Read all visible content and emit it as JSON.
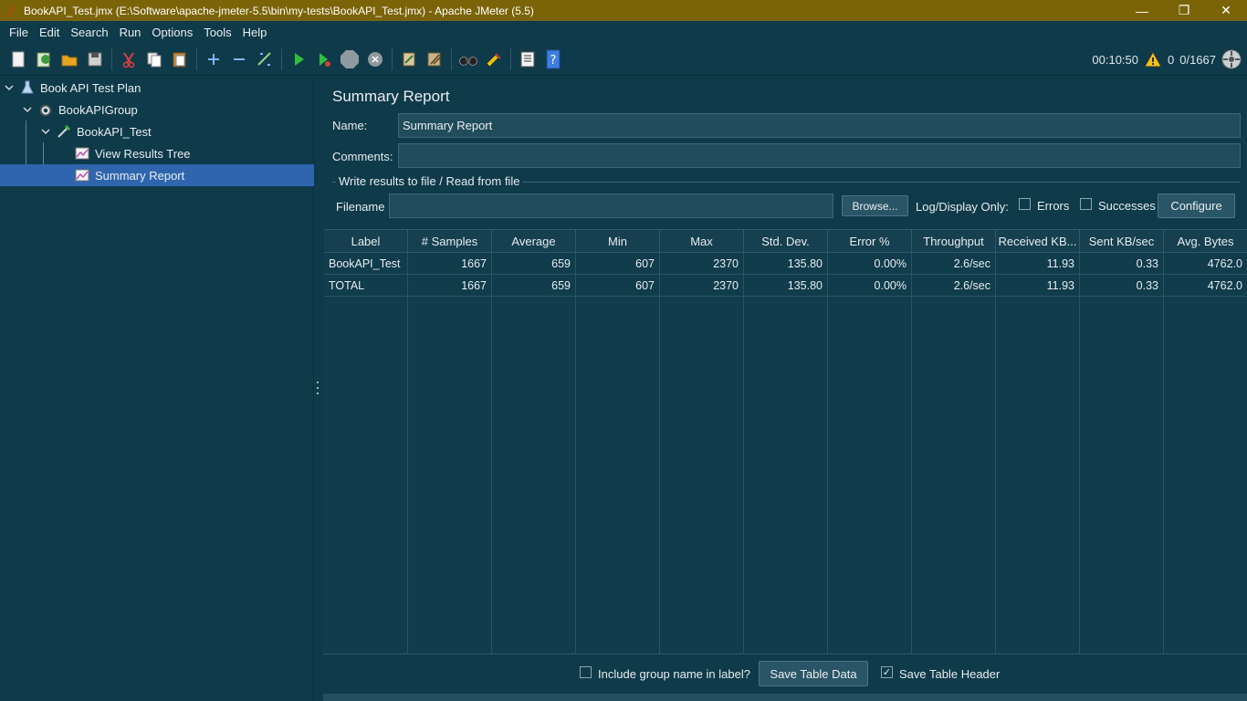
{
  "window": {
    "title": "BookAPI_Test.jmx (E:\\Software\\apache-jmeter-5.5\\bin\\my-tests\\BookAPI_Test.jmx) - Apache JMeter (5.5)",
    "minimize": "—",
    "maximize": "❐",
    "close": "✕"
  },
  "menu": [
    "File",
    "Edit",
    "Search",
    "Run",
    "Options",
    "Tools",
    "Help"
  ],
  "toolbar": {
    "elapsed": "00:10:50",
    "warnings": "0",
    "threads": "0/1667",
    "icons": [
      "new-icon",
      "templates-icon",
      "open-icon",
      "save-icon",
      "cut-icon",
      "copy-icon",
      "paste-icon",
      "expand-icon",
      "collapse-icon",
      "toggle-icon",
      "start-icon",
      "start-no-pauses-icon",
      "stop-icon",
      "shutdown-icon",
      "clear-icon",
      "clear-all-icon",
      "search-icon",
      "reset-search-icon",
      "function-helper-icon",
      "help-icon"
    ]
  },
  "tree": {
    "items": [
      {
        "label": "Book API Test Plan"
      },
      {
        "label": "BookAPIGroup"
      },
      {
        "label": "BookAPI_Test"
      },
      {
        "label": "View Results Tree"
      },
      {
        "label": "Summary Report"
      }
    ]
  },
  "panel": {
    "title": "Summary Report",
    "name_label": "Name:",
    "name_value": "Summary Report",
    "comments_label": "Comments:",
    "comments_value": "",
    "file_group_label": "Write results to file / Read from file",
    "filename_label": "Filename",
    "filename_value": "",
    "browse_label": "Browse...",
    "log_display_label": "Log/Display Only:",
    "errors_label": "Errors",
    "successes_label": "Successes",
    "configure_label": "Configure"
  },
  "table": {
    "headers": [
      "Label",
      "# Samples",
      "Average",
      "Min",
      "Max",
      "Std. Dev.",
      "Error %",
      "Throughput",
      "Received KB...",
      "Sent KB/sec",
      "Avg. Bytes"
    ],
    "rows": [
      [
        "BookAPI_Test",
        "1667",
        "659",
        "607",
        "2370",
        "135.80",
        "0.00%",
        "2.6/sec",
        "11.93",
        "0.33",
        "4762.0"
      ],
      [
        "TOTAL",
        "1667",
        "659",
        "607",
        "2370",
        "135.80",
        "0.00%",
        "2.6/sec",
        "11.93",
        "0.33",
        "4762.0"
      ]
    ]
  },
  "footer": {
    "include_group_label": "Include group name in label?",
    "include_group_checked": false,
    "save_table_data_label": "Save Table Data",
    "save_table_header_label": "Save Table Header",
    "save_table_header_checked": true
  }
}
